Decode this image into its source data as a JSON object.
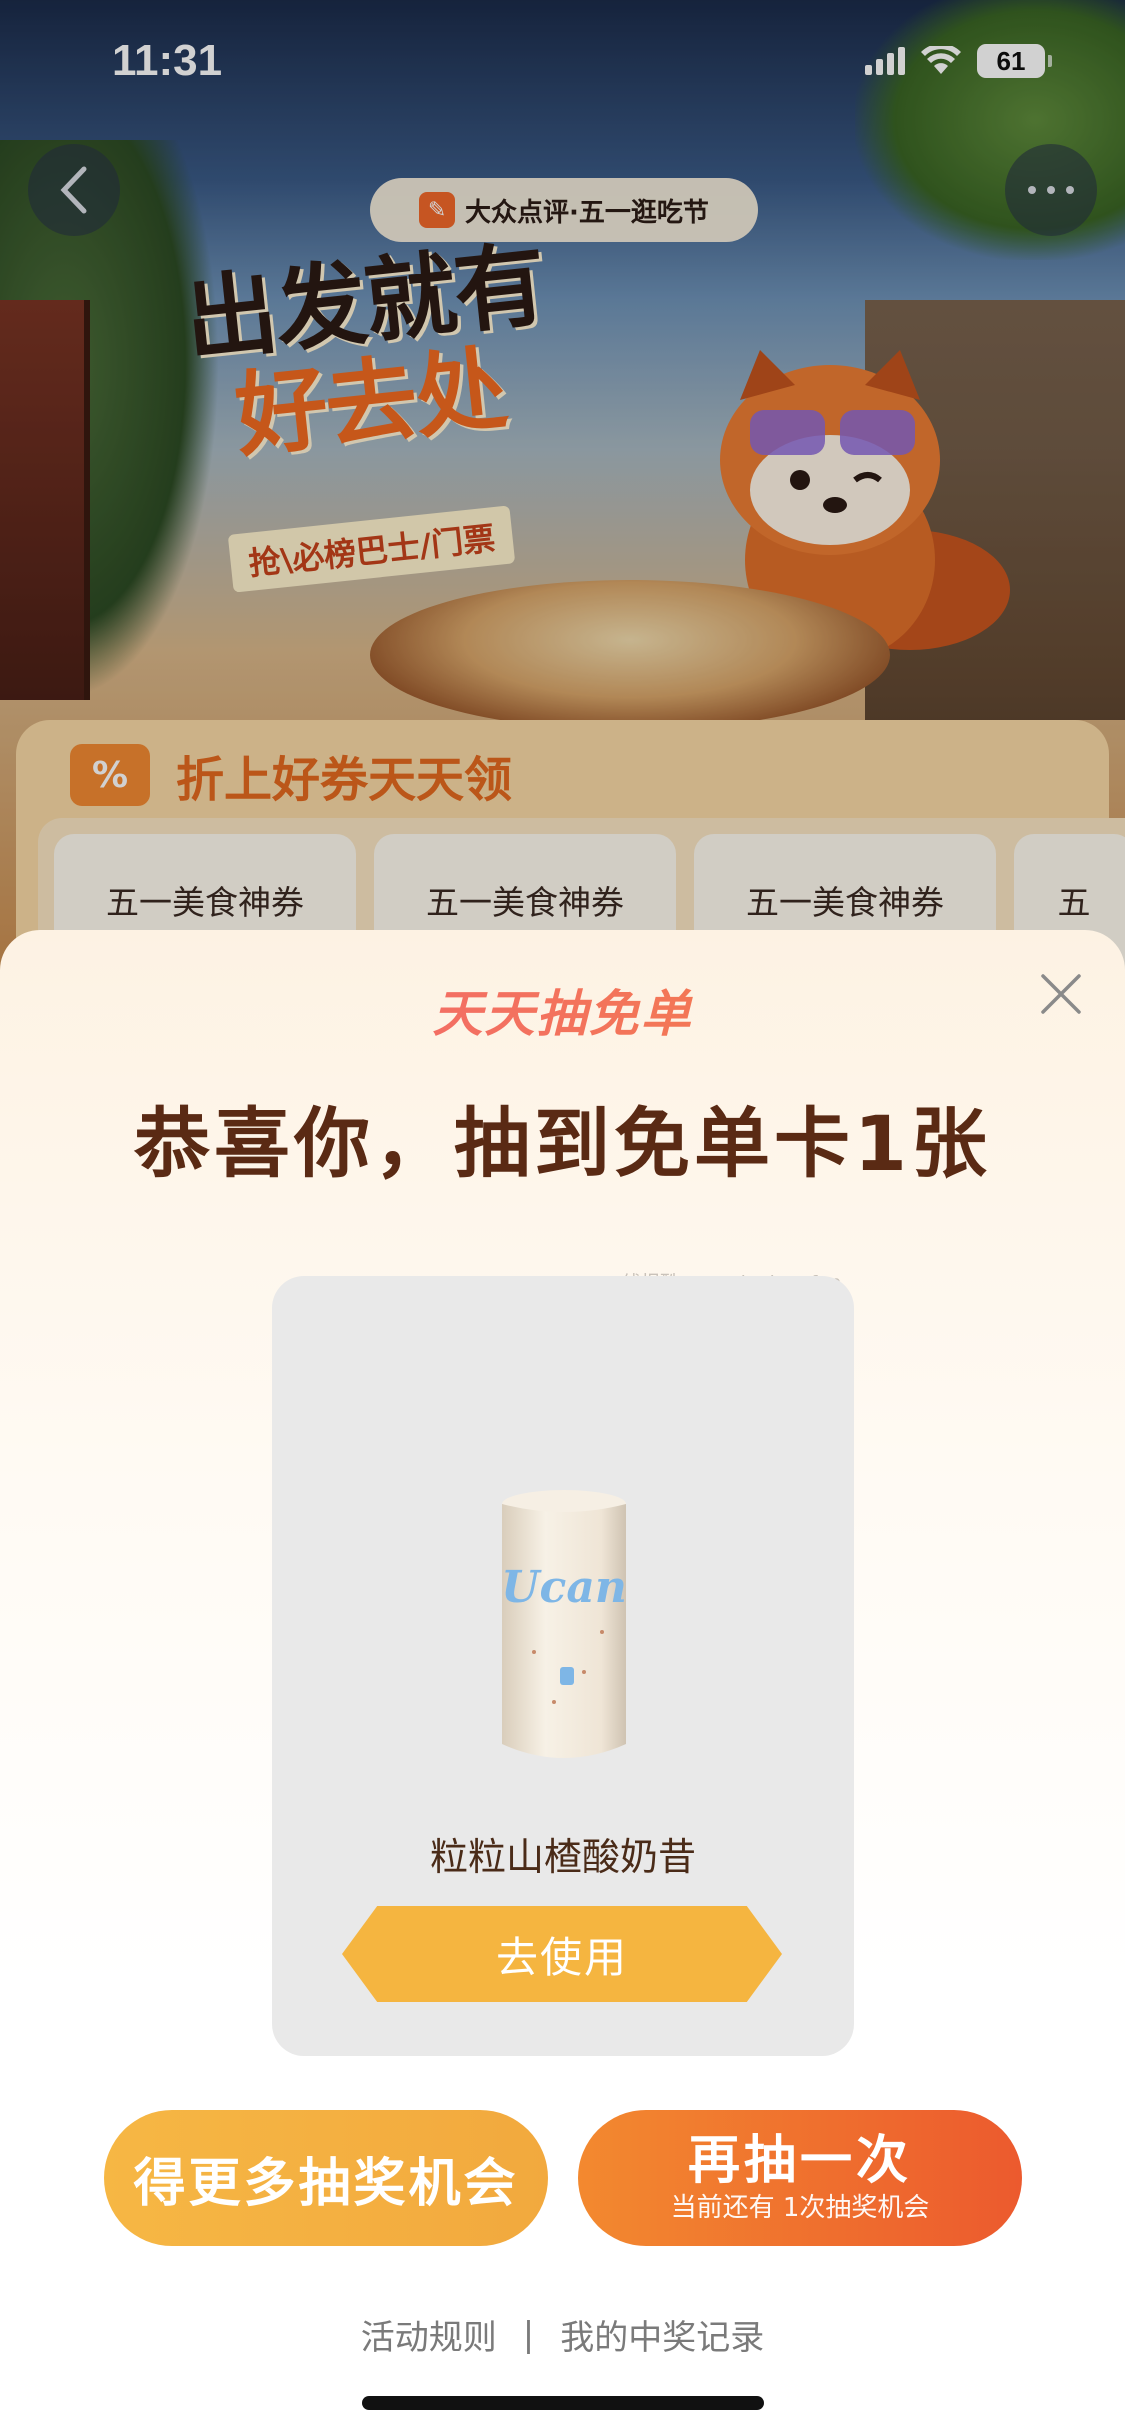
{
  "status_bar": {
    "time": "11:31",
    "battery": "61"
  },
  "campaign": {
    "brand_pill": "大众点评·五一逛吃节",
    "hero_line1": "出发就有",
    "hero_line2": "好去处",
    "hero_sub": "抢\\必榜巴士/门票",
    "coupon_title": "折上好券天天领",
    "coupon_badge": "%",
    "coupons": [
      "五一美食神券",
      "五一美食神券",
      "五一美食神券",
      "五"
    ]
  },
  "sheet": {
    "logo": "天天抽免单",
    "headline": "恭喜你，抽到免单卡1张",
    "watermark": "线报酷-new.xianbao.fun",
    "prize": {
      "name": "粒粒山楂酸奶昔",
      "can_brand": "Ucan",
      "use_button": "去使用"
    },
    "more_chances_button": "得更多抽奖机会",
    "draw_again": {
      "label": "再抽一次",
      "sub": "当前还有 1次抽奖机会"
    },
    "footer": {
      "rules": "活动规则",
      "divider": "|",
      "records": "我的中奖记录"
    }
  },
  "colors": {
    "headline": "#5a2a14",
    "use_button": "#f5b540",
    "draw_again_start": "#f3892f",
    "draw_again_end": "#ec5a2e",
    "more_button": "#f6b744"
  }
}
